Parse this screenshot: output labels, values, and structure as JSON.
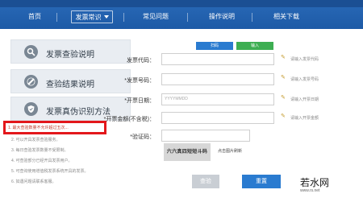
{
  "nav": {
    "items": [
      {
        "label": "首页"
      },
      {
        "label": "发票常识"
      },
      {
        "label": "常见问题"
      },
      {
        "label": "操作说明"
      },
      {
        "label": "相关下载"
      }
    ]
  },
  "sidebar": {
    "cards": [
      {
        "label": "发票查验说明",
        "icon": "magnifier-icon"
      },
      {
        "label": "查验结果说明",
        "icon": "pencil-icon"
      },
      {
        "label": "发票真伪识别方法",
        "icon": "shield-icon"
      }
    ],
    "highlighted_note": "1. 最大查验数量不允许超过五次...",
    "notes": [
      "2. 可以开具发票查验服务。",
      "3. 每日查验发票数量不受限制。",
      "4. 可查验部分已经开具发票用户。",
      "5. 可查询使用增值税发票系统开具的发票。",
      "6. 如遇问题请联系客服。"
    ]
  },
  "form": {
    "toggle_left": "扫码",
    "toggle_right": "输入",
    "fields": [
      {
        "label": "发票代码：",
        "value": "",
        "hint": "请输入发票代码"
      },
      {
        "label": "*发票号码：",
        "value": "",
        "hint": "请输入发票号码"
      },
      {
        "label": "*开票日期：",
        "value": "YYYYMMDD",
        "hint": "请输入开票日期"
      },
      {
        "label": "*开票金额(不含税)：",
        "value": "",
        "hint": "请输入开票金额"
      },
      {
        "label": "*验证码：",
        "value": "",
        "hint": ""
      }
    ],
    "captcha_text": "六六真四短短斗码",
    "captcha_tip": "点击图片刷新",
    "check_button": "查验",
    "reset_button": "重置"
  },
  "watermark": {
    "main": "若水网",
    "sub": "www.rs.net"
  },
  "colors": {
    "nav": "#1d5aa6",
    "accent": "#2a7bd0",
    "toggle_active": "#3dae52",
    "highlight": "#e3171b"
  }
}
